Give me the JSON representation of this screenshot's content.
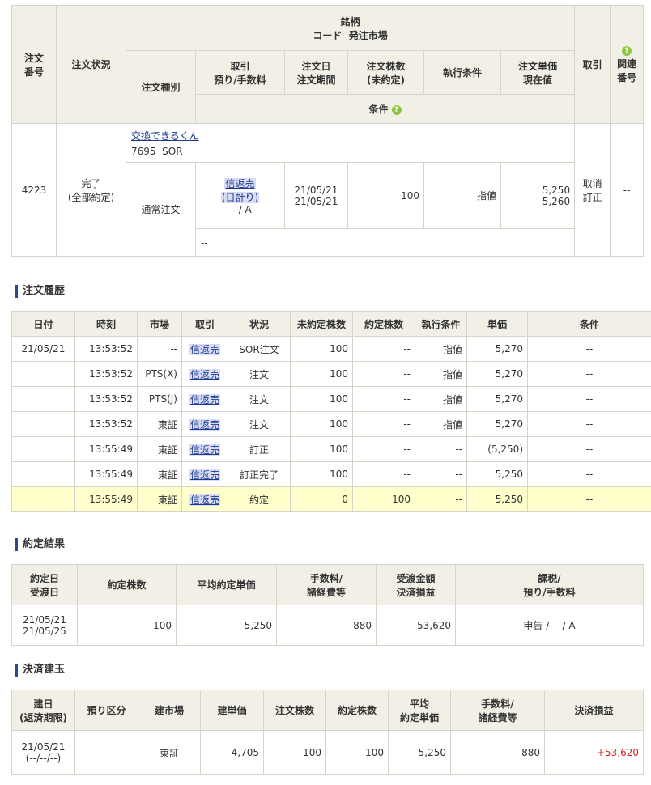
{
  "order_header": {
    "order_no": "注文\n番号",
    "status": "注文状況",
    "meigara": "銘柄",
    "code_market": "コード  発注市場",
    "order_type": "注文種別",
    "torihiki": "取引\n預り/手数料",
    "order_date": "注文日\n注文期間",
    "qty": "注文株数\n(未約定)",
    "exec": "執行条件",
    "price": "注文単価\n現在値",
    "torikeshi": "取引",
    "related": "関連\n番号",
    "joken": "条件"
  },
  "order": {
    "order_no": "4223",
    "status": "完了\n(全部約定)",
    "name": "交換できるくん",
    "code_market": "7695  SOR",
    "order_type": "通常注文",
    "torihiki_tag1": "信返売",
    "torihiki_tag2": "(日計り)",
    "fee": "-- / A",
    "dates": "21/05/21\n21/05/21",
    "qty": "100",
    "exec": "指値",
    "prices": "5,250\n5,260",
    "actions": "取消\n訂正",
    "related": "--",
    "joken": "--"
  },
  "history": {
    "title": "注文履歴",
    "headers": [
      "日付",
      "時刻",
      "市場",
      "取引",
      "状況",
      "未約定株数",
      "約定株数",
      "執行条件",
      "単価",
      "条件"
    ],
    "rows": [
      [
        "21/05/21",
        "13:53:52",
        "--",
        "信返売",
        "SOR注文",
        "100",
        "--",
        "指値",
        "5,270",
        "--"
      ],
      [
        "",
        "13:53:52",
        "PTS(X)",
        "信返売",
        "注文",
        "100",
        "--",
        "指値",
        "5,270",
        "--"
      ],
      [
        "",
        "13:53:52",
        "PTS(J)",
        "信返売",
        "注文",
        "100",
        "--",
        "指値",
        "5,270",
        "--"
      ],
      [
        "",
        "13:53:52",
        "東証",
        "信返売",
        "注文",
        "100",
        "--",
        "指値",
        "5,270",
        "--"
      ],
      [
        "",
        "13:55:49",
        "東証",
        "信返売",
        "訂正",
        "100",
        "--",
        "--",
        "(5,250)",
        "--"
      ],
      [
        "",
        "13:55:49",
        "東証",
        "信返売",
        "訂正完了",
        "100",
        "--",
        "--",
        "5,250",
        "--"
      ],
      [
        "",
        "13:55:49",
        "東証",
        "信返売",
        "約定",
        "0",
        "100",
        "--",
        "5,250",
        "--"
      ]
    ]
  },
  "result": {
    "title": "約定結果",
    "headers": [
      "約定日\n受渡日",
      "約定株数",
      "平均約定単価",
      "手数料/\n諸経費等",
      "受渡金額\n決済損益",
      "課税/\n預り/手数料"
    ],
    "row": [
      "21/05/21\n21/05/25",
      "100",
      "5,250",
      "880",
      "53,620",
      "申告 / -- / A"
    ]
  },
  "settle": {
    "title": "決済建玉",
    "headers": [
      "建日\n(返済期限)",
      "預り区分",
      "建市場",
      "建単価",
      "注文株数",
      "約定株数",
      "平均\n約定単価",
      "手数料/\n諸経費等",
      "決済損益"
    ],
    "row": [
      "21/05/21\n(--/--/--)",
      "--",
      "東証",
      "4,705",
      "100",
      "100",
      "5,250",
      "880",
      "+53,620"
    ]
  }
}
